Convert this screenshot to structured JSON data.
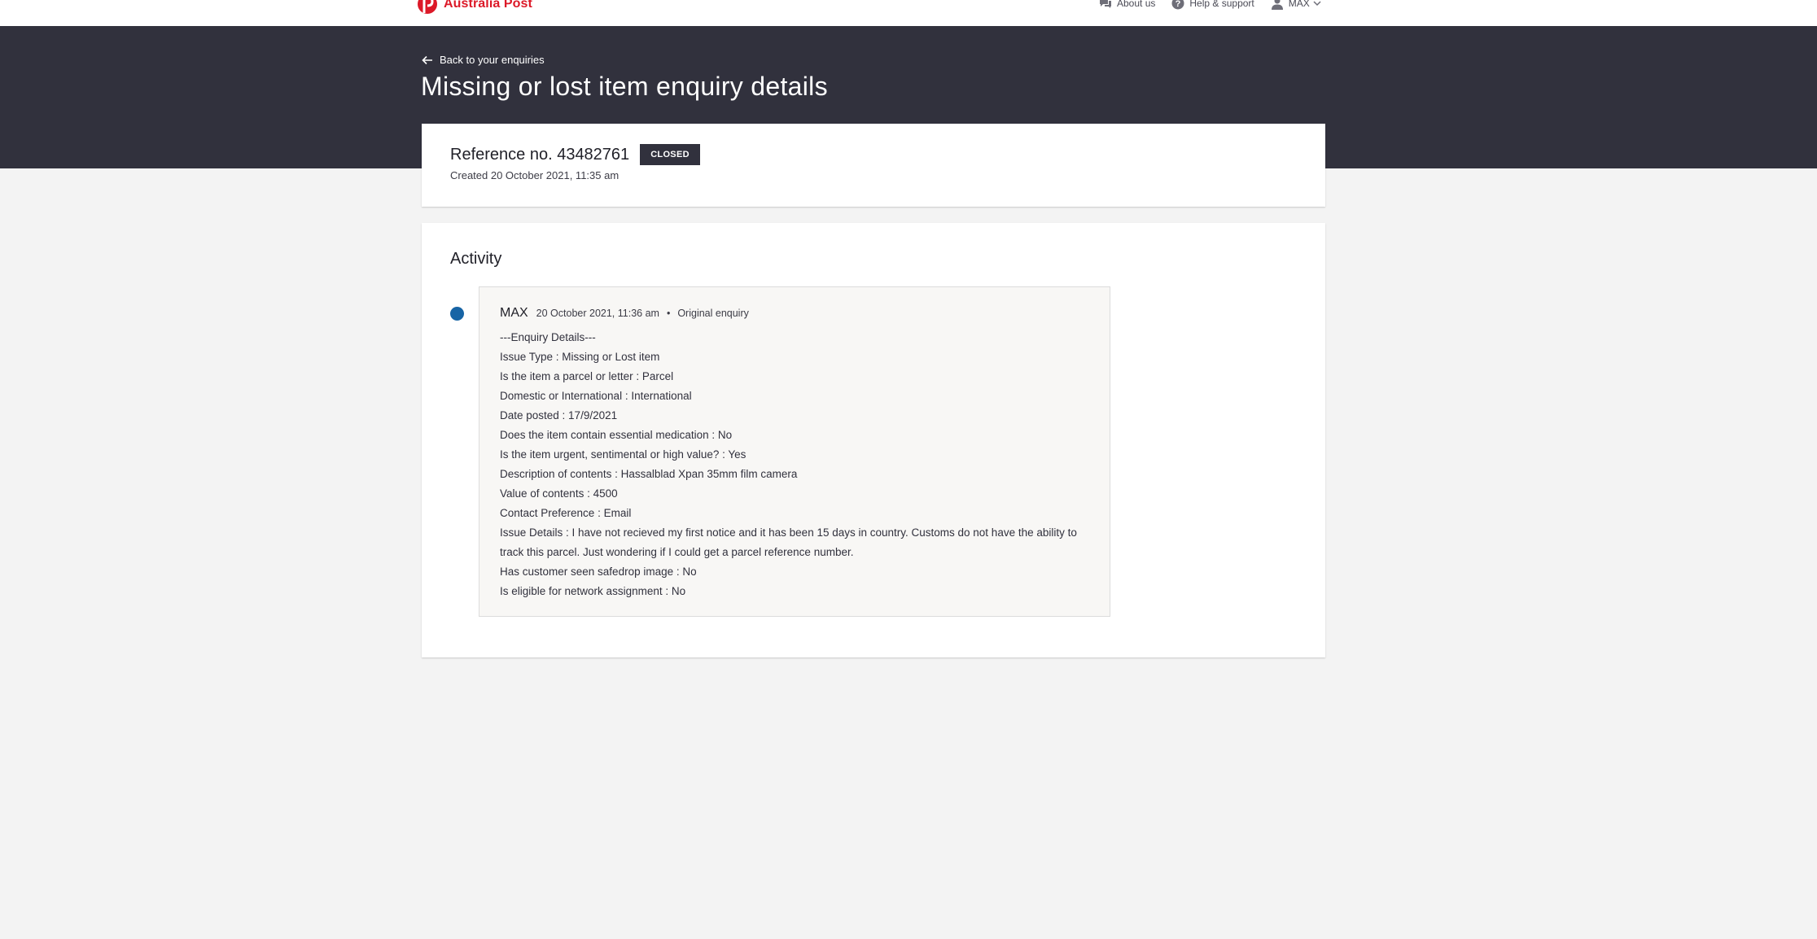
{
  "brand": {
    "name": "Australia Post",
    "color": "#dc1928"
  },
  "topnav": {
    "about": "About us",
    "help": "Help & support",
    "user": "MAX"
  },
  "header": {
    "back_label": "Back to your enquiries",
    "title": "Missing or lost item enquiry details"
  },
  "reference": {
    "label": "Reference no. 43482761",
    "status": "CLOSED",
    "created": "Created 20 October 2021, 11:35 am"
  },
  "activity": {
    "title": "Activity",
    "entries": [
      {
        "author": "MAX",
        "timestamp": "20 October 2021, 11:36 am",
        "separator": "•",
        "type": "Original enquiry",
        "lines": [
          "---Enquiry Details---",
          "Issue Type : Missing or Lost item",
          "Is the item a parcel or letter : Parcel",
          "Domestic or International : International",
          "Date posted : 17/9/2021",
          "Does the item contain essential medication : No",
          "Is the item urgent, sentimental or high value? : Yes",
          "Description of contents : Hassalblad Xpan 35mm film camera",
          "Value of contents : 4500",
          "Contact Preference : Email",
          "Issue Details : I have not recieved my first notice and it has been 15 days in country. Customs do not have the ability to track this parcel. Just wondering if I could get a parcel reference number.",
          "Has customer seen safedrop image : No",
          "Is eligible for network assignment : No"
        ]
      }
    ]
  },
  "colors": {
    "hero": "#31313d",
    "background": "#f3f3f3",
    "timeline_dot": "#1764a5"
  }
}
